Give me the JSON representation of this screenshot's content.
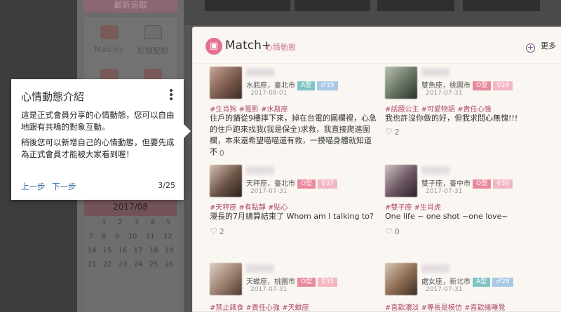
{
  "background": {
    "sidebar_top_button": "最新追蹤",
    "tiles": [
      {
        "label": "Match+",
        "icon": "heart-icon"
      },
      {
        "label": "紅娘配對",
        "icon": "monitor-icon"
      }
    ],
    "calendar": {
      "header": "2017/08",
      "rows": [
        [
          "",
          "1",
          "2",
          "3",
          "4",
          "5"
        ],
        [
          "7",
          "8",
          "9",
          "10",
          "11",
          "12"
        ],
        [
          "14",
          "15",
          "16",
          "17",
          "18",
          "19"
        ],
        [
          "21",
          "22",
          "23",
          "24",
          "25",
          "26"
        ]
      ]
    }
  },
  "panel": {
    "title": "Match+",
    "subtitle": "心情動態",
    "more_label": "更多",
    "posts": [
      {
        "location": "水瓶座，臺北市",
        "blood": "A型",
        "sex_age": "♂35",
        "date": "2017-08-01",
        "tags": "#生肖狗 #電影 #水瓶座",
        "text": "住戶的貓從9樓摔下來，掉在台電的圍欄裡，心急的住戶跑來找我(我是保全)求救，我直接爬進圍欄，本來還希望喵喵還有救，一摸喵身體就知道不",
        "likes": "0"
      },
      {
        "location": "雙魚座，桃園市",
        "blood": "O型",
        "sex_age": "♀24",
        "date": "2017-07-31",
        "tags": "#話題公主 #可愛物語 #責任心強",
        "text": "我也許沒你做的好，但我求問心無愧!!!",
        "likes": "2"
      },
      {
        "location": "天秤座，臺北市",
        "blood": "O型",
        "sex_age": "♀37",
        "date": "2017-07-31",
        "tags": "#天秤座 #有點靜 #貼心",
        "text": "漫長的7月總算結束了 Whom am I talking to?",
        "likes": "2"
      },
      {
        "location": "雙子座，臺中市",
        "blood": "O型",
        "sex_age": "♀30",
        "date": "2017-07-31",
        "tags": "#雙子座 #生肖虎",
        "text": "One life ~ one shot ~one love~",
        "likes": "0"
      },
      {
        "location": "天蠍座，桃園市",
        "blood": "O型",
        "sex_age": "♀33",
        "date": "2017-07-31",
        "tags": "#禁止錶食 #責任心強 #天蠍座",
        "text": "",
        "likes": ""
      },
      {
        "location": "處女座，新北市",
        "blood": "A型",
        "sex_age": "♂29",
        "date": "2017-07-31",
        "tags": "#喜歡濃淡 #專長是模仿 #喜歡緣睡覺",
        "text": "",
        "likes": ""
      }
    ]
  },
  "tooltip": {
    "title": "心情動態介紹",
    "paragraph1": "這是正式會員分享的心情動態，您可以自由地跟有共鳴的對象互動。",
    "paragraph2": "稍後您可以新增自己的心情動態，但要先成為正式會員才能被大家看到喔！",
    "prev_label": "上一步",
    "next_label": "下一步",
    "step_count": "3/25"
  },
  "colors": {
    "accent_pink": "#e5708f",
    "tag_color": "#b04a6a",
    "link_blue": "#3366aa",
    "blood_o": "#e9899e",
    "blood_a": "#7fc4c4"
  }
}
